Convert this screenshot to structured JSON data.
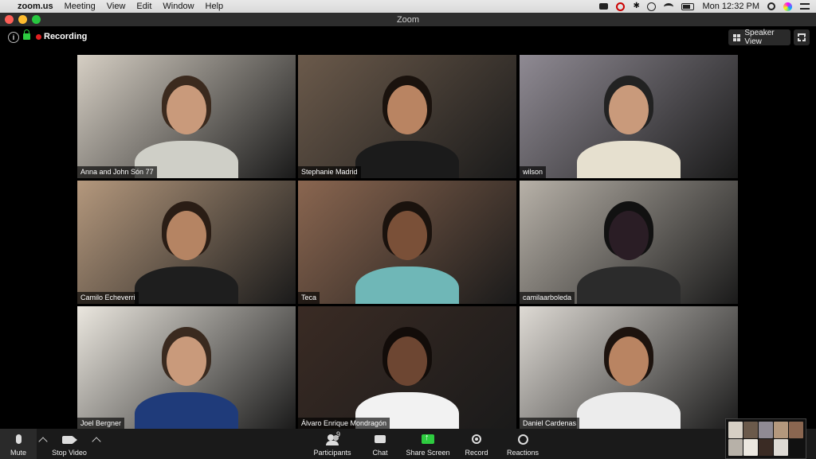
{
  "menubar": {
    "app_name": "zoom.us",
    "menus": [
      "Meeting",
      "View",
      "Edit",
      "Window",
      "Help"
    ],
    "clock": "Mon 12:32 PM"
  },
  "window": {
    "title": "Zoom"
  },
  "meeting": {
    "recording_label": "Recording",
    "speaker_view_label": "Speaker View"
  },
  "participants": [
    {
      "name": "Anna and John Són 77",
      "bg": "#d6cfc4",
      "skin": "#c99a7b",
      "shirt": "#cfcfc7",
      "hair": "#3b2a1e"
    },
    {
      "name": "Stephanie Madrid",
      "bg": "#6b5a4b",
      "skin": "#b98462",
      "shirt": "#1b1b1b",
      "hair": "#1a120d"
    },
    {
      "name": "wilson",
      "bg": "#8f8a93",
      "skin": "#c99a7b",
      "shirt": "#e6e0cf",
      "hair": "#222"
    },
    {
      "name": "Camilo Echeverri",
      "bg": "#b4987d",
      "skin": "#b58463",
      "shirt": "#1e1e1e",
      "hair": "#2a1d15"
    },
    {
      "name": "Teca",
      "bg": "#8a6650",
      "skin": "#7a5038",
      "shirt": "#6fb7b7",
      "hair": "#1a120d"
    },
    {
      "name": "camilaarboleda",
      "bg": "#b7b1a8",
      "skin": "#2a1d25",
      "shirt": "#2b2b2b",
      "hair": "#111"
    },
    {
      "name": "Joel Bergner",
      "bg": "#ebe7df",
      "skin": "#c99a7b",
      "shirt": "#1f3b7a",
      "hair": "#3a2a1f"
    },
    {
      "name": "Álvaro Enrique Mondragón",
      "bg": "#3a2b24",
      "skin": "#6d4632",
      "shirt": "#f2f2f2",
      "hair": "#120c09"
    },
    {
      "name": "Daniel Cardenas",
      "bg": "#dedad4",
      "skin": "#b98462",
      "shirt": "#ececec",
      "hair": "#1d130e"
    }
  ],
  "toolbar": {
    "mute_label": "Mute",
    "stop_video_label": "Stop Video",
    "participants_label": "Participants",
    "participants_count": "9",
    "chat_label": "Chat",
    "share_screen_label": "Share Screen",
    "record_label": "Record",
    "reactions_label": "Reactions"
  },
  "colors": {
    "active_speaker_outline": "#d4e157",
    "share_green": "#2ecc40",
    "recording_red": "#e02020"
  }
}
